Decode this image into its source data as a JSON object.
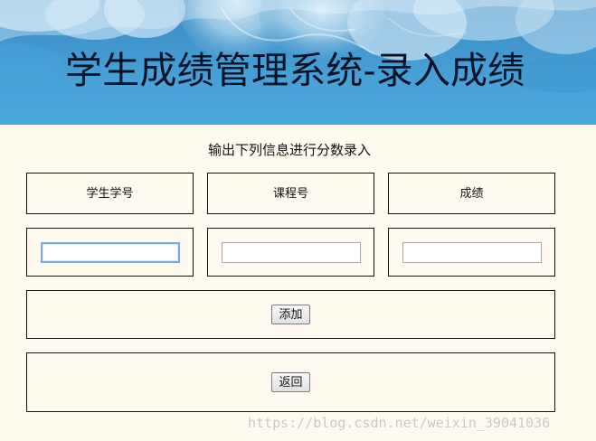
{
  "banner": {
    "title": "学生成绩管理系统-录入成绩"
  },
  "form": {
    "instruction": "输出下列信息进行分数录入",
    "columns": [
      "学生学号",
      "课程号",
      "成绩"
    ],
    "inputs": [
      {
        "value": "",
        "placeholder": "",
        "focused": true
      },
      {
        "value": "",
        "placeholder": "",
        "focused": false
      },
      {
        "value": "",
        "placeholder": "",
        "focused": false
      }
    ]
  },
  "actions": {
    "add_label": "添加",
    "back_label": "返回"
  },
  "watermark": {
    "text": "https://blog.csdn.net/weixin_39041036"
  },
  "colors": {
    "page_background": "#fffaef",
    "banner_blue": "#4aa0d6",
    "title_text": "#071427",
    "border": "#111111",
    "focus_border": "#7ea7da"
  }
}
